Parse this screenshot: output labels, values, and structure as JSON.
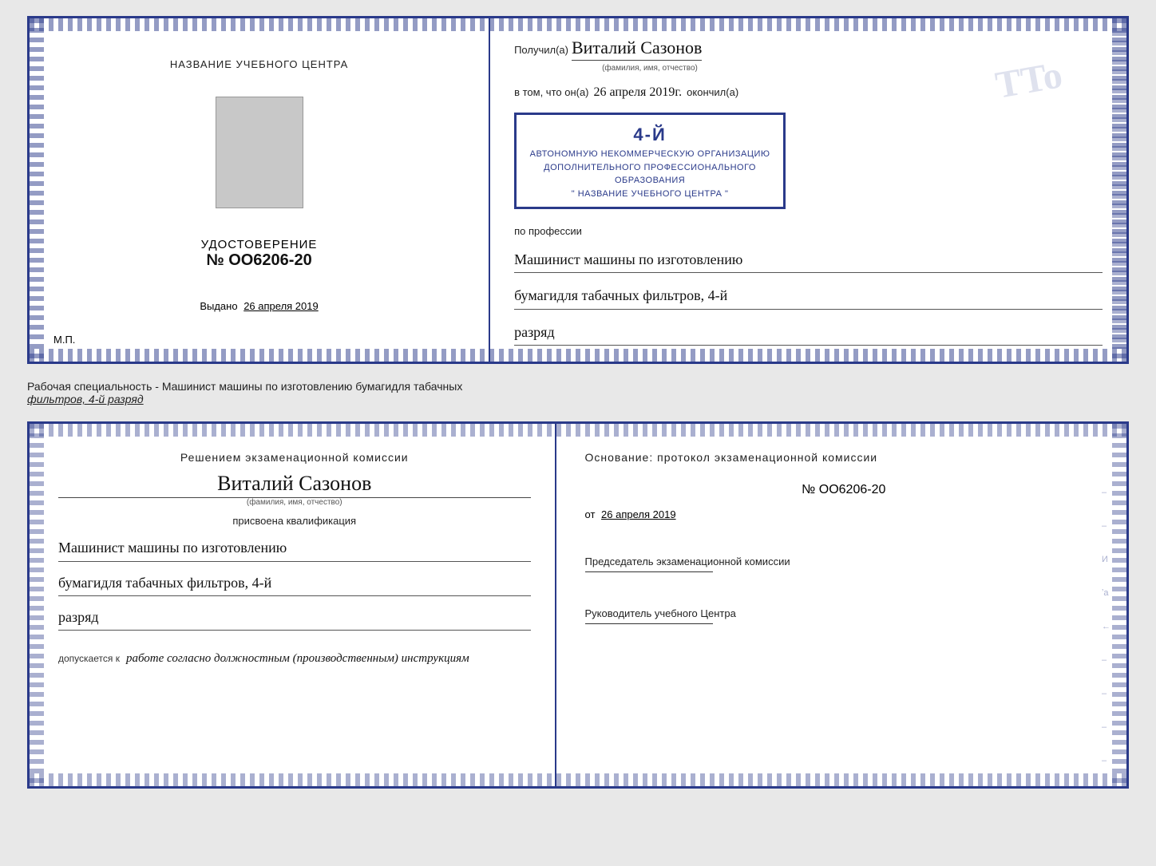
{
  "top_doc": {
    "left": {
      "institution_label": "НАЗВАНИЕ УЧЕБНОГО ЦЕНТРА",
      "cert_title": "УДОСТОВЕРЕНИЕ",
      "cert_number": "№ OO6206-20",
      "issued_label": "Выдано",
      "issued_date": "26 апреля 2019",
      "mp_label": "М.П."
    },
    "right": {
      "received_prefix": "Получил(а)",
      "recipient_name": "Виталий Сазонов",
      "name_subtext": "(фамилия, имя, отчество)",
      "in_that_prefix": "в том, что он(а)",
      "completion_date": "26 апреля 2019г.",
      "completed_suffix": "окончил(а)",
      "stamp_line1": "АВТОНОМНУЮ НЕКОММЕРЧЕСКУЮ ОРГАНИЗАЦИЮ",
      "stamp_line2": "ДОПОЛНИТЕЛЬНОГО ПРОФЕССИОНАЛЬНОГО ОБРАЗОВАНИЯ",
      "stamp_line3": "\" НАЗВАНИЕ УЧЕБНОГО ЦЕНТРА \"",
      "stamp_big": "4-й",
      "profession_label": "по профессии",
      "profession_line1": "Машинист машины по изготовлению",
      "profession_line2": "бумагидля табачных фильтров, 4-й",
      "profession_line3": "разряд"
    }
  },
  "middle": {
    "text_main": "Рабочая специальность - Машинист машины по изготовлению бумагидля табачных",
    "text_underlined": "фильтров, 4-й разряд"
  },
  "bottom_doc": {
    "left": {
      "decision_text": "Решением экзаменационной комиссии",
      "person_name": "Виталий Сазонов",
      "name_subtext": "(фамилия, имя, отчество)",
      "assigned_text": "присвоена квалификация",
      "qual_line1": "Машинист машины по изготовлению",
      "qual_line2": "бумагидля табачных фильтров, 4-й",
      "qual_line3": "разряд",
      "admission_label": "допускается к",
      "admission_text": "работе согласно должностным (производственным) инструкциям"
    },
    "right": {
      "basis_text": "Основание: протокол экзаменационной комиссии",
      "protocol_number": "№ OO6206-20",
      "from_prefix": "от",
      "from_date": "26 апреля 2019",
      "chair_title": "Председатель экзаменационной комиссии",
      "head_title": "Руководитель учебного Центра"
    }
  },
  "watermark": "TTo"
}
